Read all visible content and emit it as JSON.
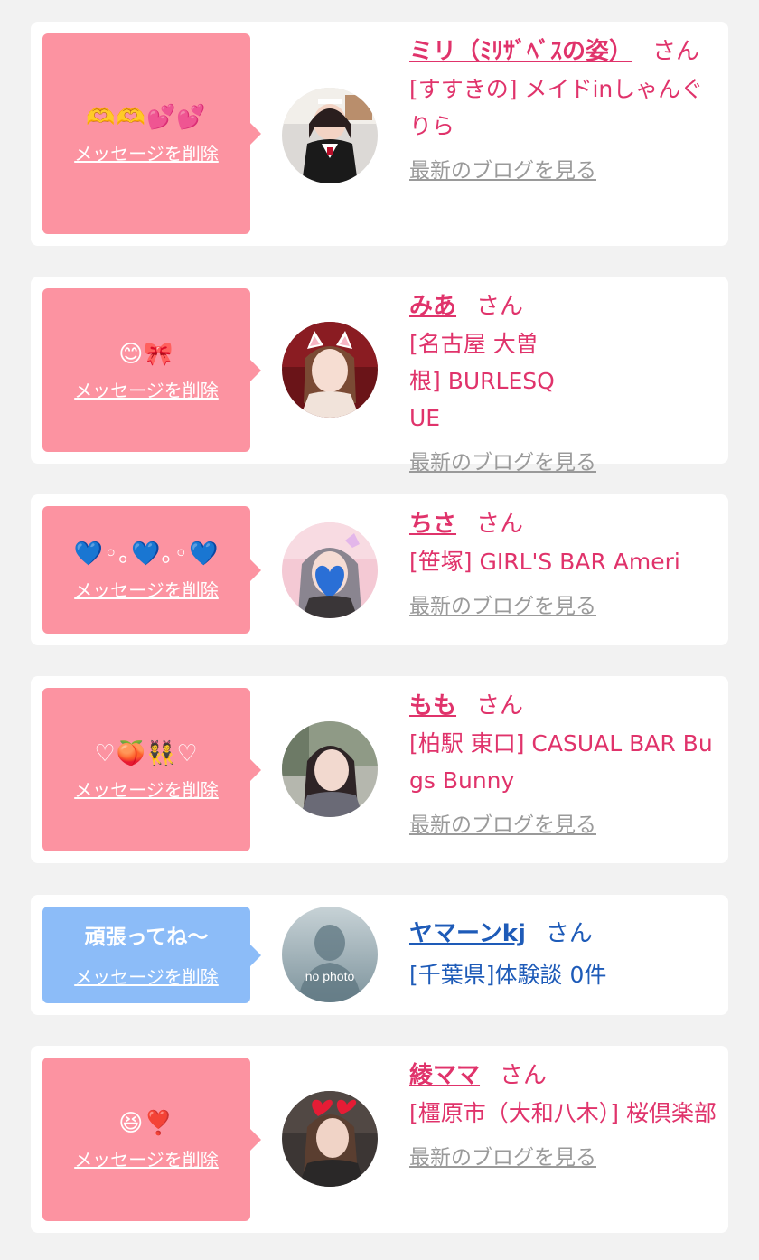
{
  "common": {
    "delete_label": "メッセージを削除",
    "san": "さん",
    "blog_label": "最新のブログを見る"
  },
  "items": [
    {
      "message": "🫶🫶💕💕",
      "name": "ミリ（ﾐﾘｻﾞﾍﾞｽの姿）",
      "shop": "[すすきの] メイドinしゃんぐりら"
    },
    {
      "message": "😊🎀",
      "name": "みあ",
      "shop": "[名古屋 大曽根] BURLESQUE"
    },
    {
      "message": "💙◦｡💙｡◦💙",
      "name": "ちさ",
      "shop": "[笹塚] GIRL'S BAR Ameri"
    },
    {
      "message": "♡🍑👯♡",
      "name": "もも",
      "shop": "[柏駅 東口] CASUAL BAR Bugs Bunny"
    },
    {
      "message": "頑張ってね〜",
      "name": "ヤマーンkj",
      "shop": "[千葉県]体験談 0件",
      "avatar_text": "no photo"
    },
    {
      "message": "😆❣️",
      "name": "綾ママ",
      "shop": "[橿原市（大和八木）] 桜倶楽部"
    }
  ],
  "colors": {
    "background": "#f2f2f2",
    "card": "#ffffff",
    "pink_bubble": "#fc93a1",
    "blue_bubble": "#8cbcf8",
    "accent_pink": "#e0336b",
    "accent_blue": "#1e5bb8",
    "muted_link": "#9a9a9a"
  }
}
